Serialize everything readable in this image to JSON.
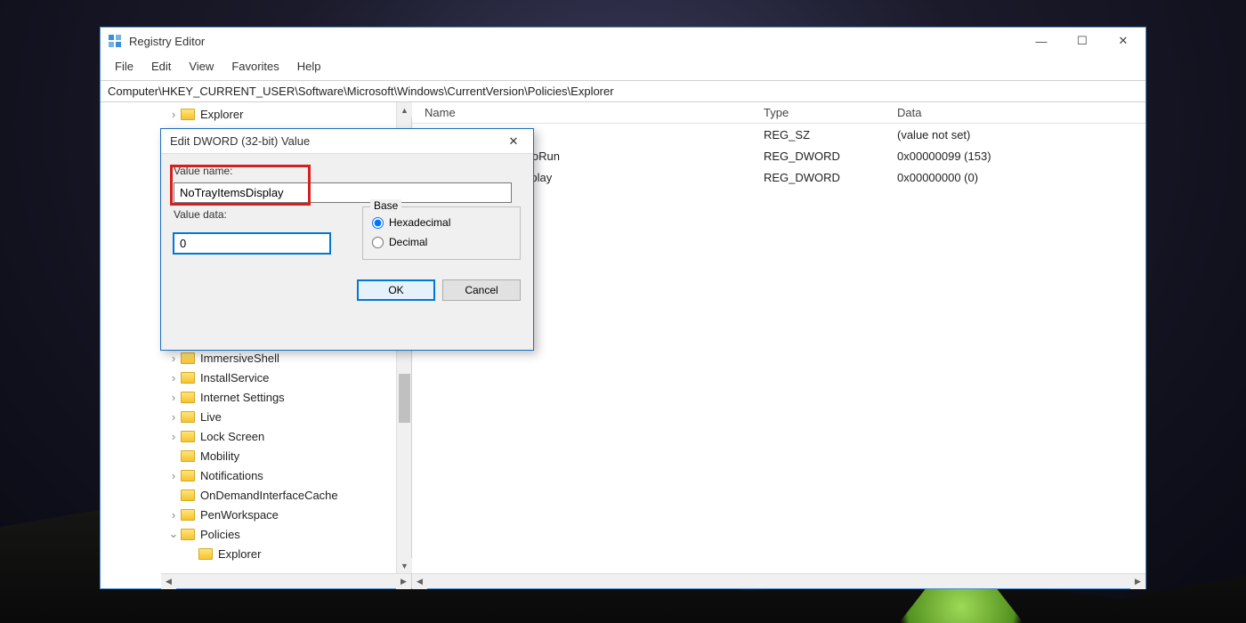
{
  "window": {
    "title": "Registry Editor",
    "controls": {
      "min": "—",
      "max": "☐",
      "close": "✕"
    }
  },
  "menu": [
    "File",
    "Edit",
    "View",
    "Favorites",
    "Help"
  ],
  "address": "Computer\\HKEY_CURRENT_USER\\Software\\Microsoft\\Windows\\CurrentVersion\\Policies\\Explorer",
  "tree": {
    "top": "Explorer",
    "items": [
      "ImmersiveShell",
      "InstallService",
      "Internet Settings",
      "Live",
      "Lock Screen",
      "Mobility",
      "Notifications",
      "OnDemandInterfaceCache",
      "PenWorkspace",
      "Policies",
      "Explorer"
    ]
  },
  "list": {
    "headers": {
      "name": "Name",
      "type": "Type",
      "data": "Data"
    },
    "rows": [
      {
        "name_suffix": "",
        "type": "REG_SZ",
        "data": "(value not set)"
      },
      {
        "name_suffix": "utoRun",
        "type": "REG_DWORD",
        "data": "0x00000099 (153)"
      },
      {
        "name_suffix": "isplay",
        "type": "REG_DWORD",
        "data": "0x00000000 (0)"
      }
    ]
  },
  "dialog": {
    "title": "Edit DWORD (32-bit) Value",
    "value_name_label": "Value name:",
    "value_name": "NoTrayItemsDisplay",
    "value_data_label": "Value data:",
    "value_data": "0",
    "base_label": "Base",
    "radios": {
      "hex": "Hexadecimal",
      "dec": "Decimal"
    },
    "buttons": {
      "ok": "OK",
      "cancel": "Cancel"
    },
    "close": "✕"
  }
}
